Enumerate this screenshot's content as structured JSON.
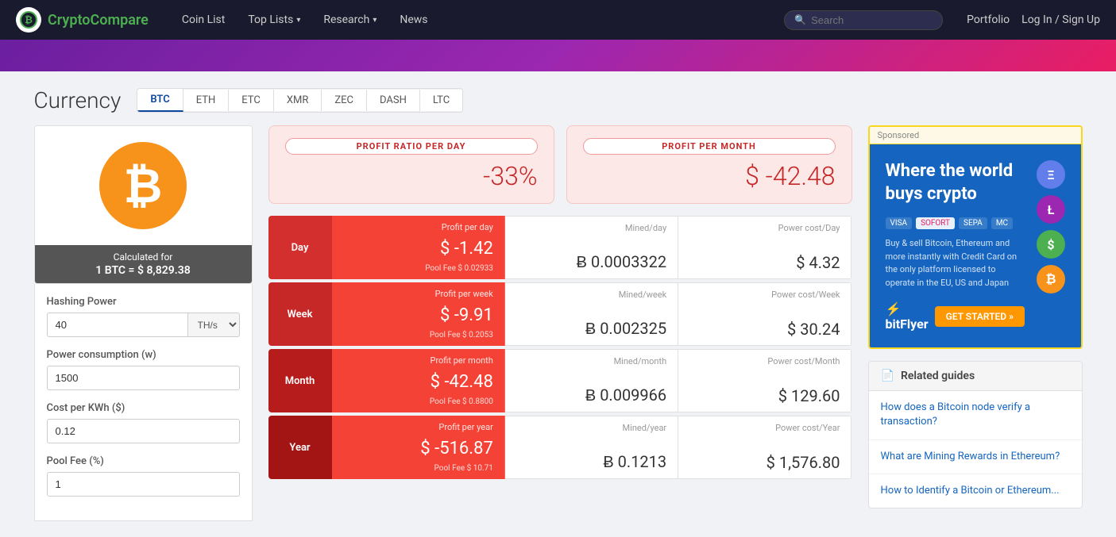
{
  "navbar": {
    "logo_text1": "Crypto",
    "logo_text2": "Compare",
    "coin_list": "Coin List",
    "top_lists": "Top Lists",
    "research": "Research",
    "news": "News",
    "search_placeholder": "Search",
    "portfolio": "Portfolio",
    "login": "Log In / Sign Up"
  },
  "currency": {
    "title": "Currency",
    "tabs": [
      "BTC",
      "ETH",
      "ETC",
      "XMR",
      "ZEC",
      "DASH",
      "LTC"
    ],
    "active_tab": "BTC"
  },
  "coin": {
    "calculated_for": "Calculated for",
    "rate": "1 BTC = $ 8,829.38"
  },
  "form": {
    "hashing_power_label": "Hashing Power",
    "hashing_power_value": "40",
    "hashing_unit": "TH/s",
    "power_consumption_label": "Power consumption (w)",
    "power_consumption_value": "1500",
    "cost_per_kwh_label": "Cost per KWh ($)",
    "cost_per_kwh_value": "0.12",
    "pool_fee_label": "Pool Fee (%)",
    "pool_fee_value": "1"
  },
  "profit_summary": {
    "ratio_label": "PROFIT RATIO PER DAY",
    "ratio_value": "-33%",
    "month_label": "PROFIT PER MONTH",
    "month_value": "$ -42.48"
  },
  "data_rows": [
    {
      "period": "Day",
      "profit_label": "Profit per day",
      "profit_value": "$ -1.42",
      "pool_fee": "Pool Fee $ 0.02933",
      "mined_label": "Mined/day",
      "mined_value": "Ƀ 0.0003322",
      "power_label": "Power cost/Day",
      "power_value": "$ 4.32"
    },
    {
      "period": "Week",
      "profit_label": "Profit per week",
      "profit_value": "$ -9.91",
      "pool_fee": "Pool Fee $ 0.2053",
      "mined_label": "Mined/week",
      "mined_value": "Ƀ 0.002325",
      "power_label": "Power cost/Week",
      "power_value": "$ 30.24"
    },
    {
      "period": "Month",
      "profit_label": "Profit per month",
      "profit_value": "$ -42.48",
      "pool_fee": "Pool Fee $ 0.8800",
      "mined_label": "Mined/month",
      "mined_value": "Ƀ 0.009966",
      "power_label": "Power cost/Month",
      "power_value": "$ 129.60"
    },
    {
      "period": "Year",
      "profit_label": "Profit per year",
      "profit_value": "$ -516.87",
      "pool_fee": "Pool Fee $ 10.71",
      "mined_label": "Mined/year",
      "mined_value": "Ƀ 0.1213",
      "power_label": "Power cost/Year",
      "power_value": "$ 1,576.80"
    }
  ],
  "ad": {
    "sponsored": "Sponsored",
    "headline": "Where the world buys crypto",
    "body": "Buy & sell Bitcoin, Ethereum and more instantly with Credit Card on the only platform licensed to operate in the EU, US and Japan",
    "cta": "GET STARTED »",
    "brand": "bitFlyer"
  },
  "guides": {
    "header": "Related guides",
    "items": [
      "How does a Bitcoin node verify a transaction?",
      "What are Mining Rewards in Ethereum?",
      "How to Identify a Bitcoin or Ethereum..."
    ]
  }
}
